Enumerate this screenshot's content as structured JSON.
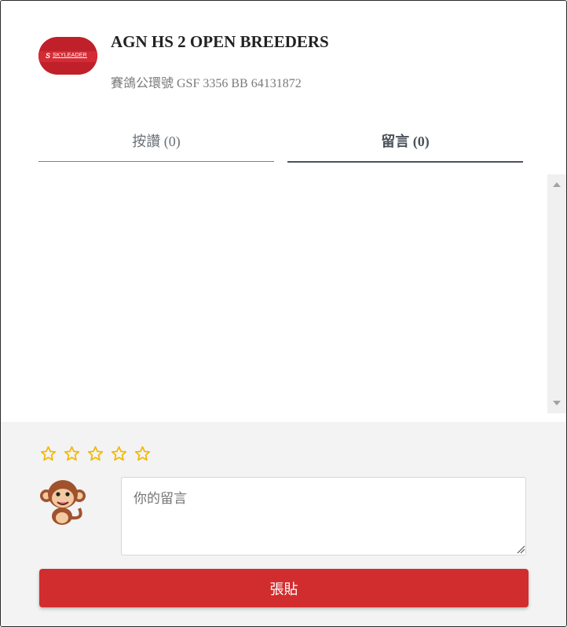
{
  "header": {
    "logo_text": "SKYLEADER",
    "title": "AGN HS 2 OPEN BREEDERS",
    "subtitle": "賽鴿公環號 GSF 3356 BB 64131872"
  },
  "tabs": [
    {
      "label": "按讚 (0)",
      "active": false
    },
    {
      "label": "留言 (0)",
      "active": true
    }
  ],
  "rating": {
    "max": 5,
    "value": 0,
    "color": "#f2b705"
  },
  "comment": {
    "placeholder": "你的留言",
    "value": ""
  },
  "submit_label": "張貼",
  "colors": {
    "accent": "#d12d2f",
    "logo": "#c0202a"
  }
}
